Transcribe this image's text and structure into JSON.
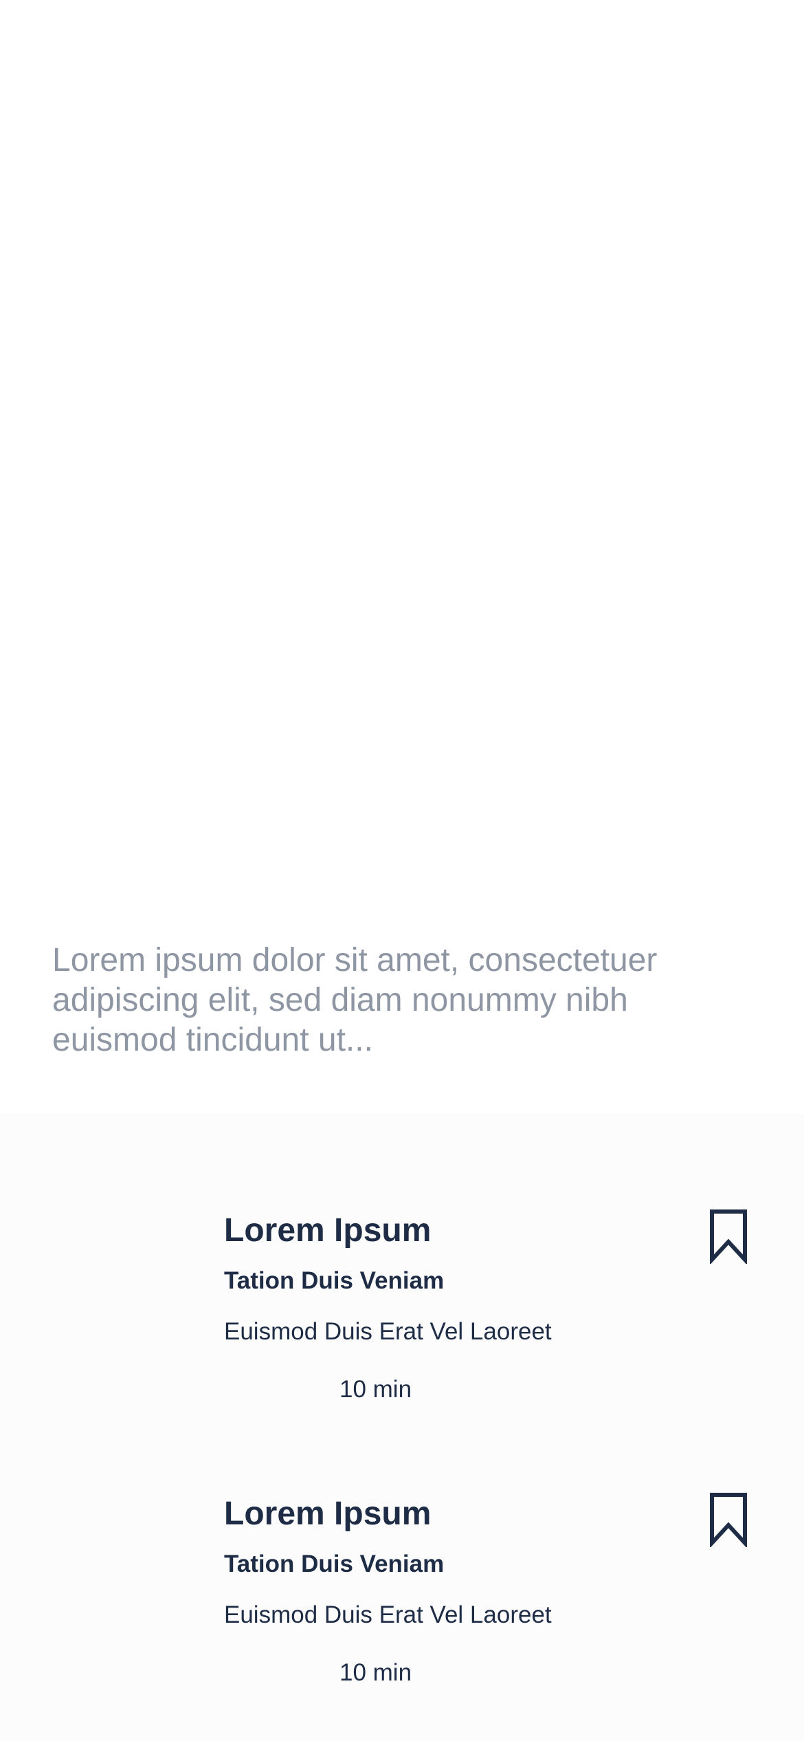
{
  "intro": {
    "text": "Lorem ipsum dolor sit amet, consectetuer adipiscing elit, sed diam nonummy nibh euismod tincidunt ut..."
  },
  "cards": [
    {
      "title": "Lorem Ipsum",
      "subtitle": "Tation Duis Veniam",
      "description": "Euismod Duis Erat Vel Laoreet",
      "duration": "10 min",
      "icon": "bookmark-icon"
    },
    {
      "title": "Lorem Ipsum",
      "subtitle": "Tation Duis Veniam",
      "description": "Euismod Duis Erat Vel Laoreet",
      "duration": "10 min",
      "icon": "bookmark-icon"
    }
  ],
  "colors": {
    "text_primary": "#1e2d45",
    "text_muted": "#8e96a3",
    "background": "#ffffff"
  }
}
